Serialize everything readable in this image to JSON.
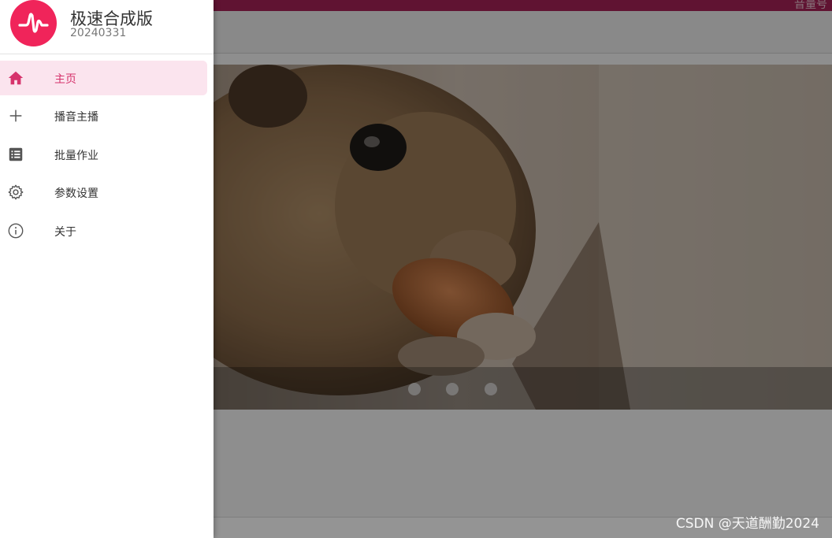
{
  "background": {
    "topbar_text": "音量号",
    "carousel_dots": 3
  },
  "drawer": {
    "title": "极速合成版",
    "version": "20240331",
    "items": [
      {
        "label": "主页",
        "icon": "home-icon",
        "active": true
      },
      {
        "label": "播音主播",
        "icon": "plus-icon",
        "active": false
      },
      {
        "label": "批量作业",
        "icon": "list-icon",
        "active": false
      },
      {
        "label": "参数设置",
        "icon": "gear-icon",
        "active": false
      },
      {
        "label": "关于",
        "icon": "info-icon",
        "active": false
      }
    ]
  },
  "watermark": "CSDN @天道酬勤2024",
  "colors": {
    "accent": "#f0245a",
    "active_bg": "#fbe4ee",
    "topbar": "#a52257"
  }
}
